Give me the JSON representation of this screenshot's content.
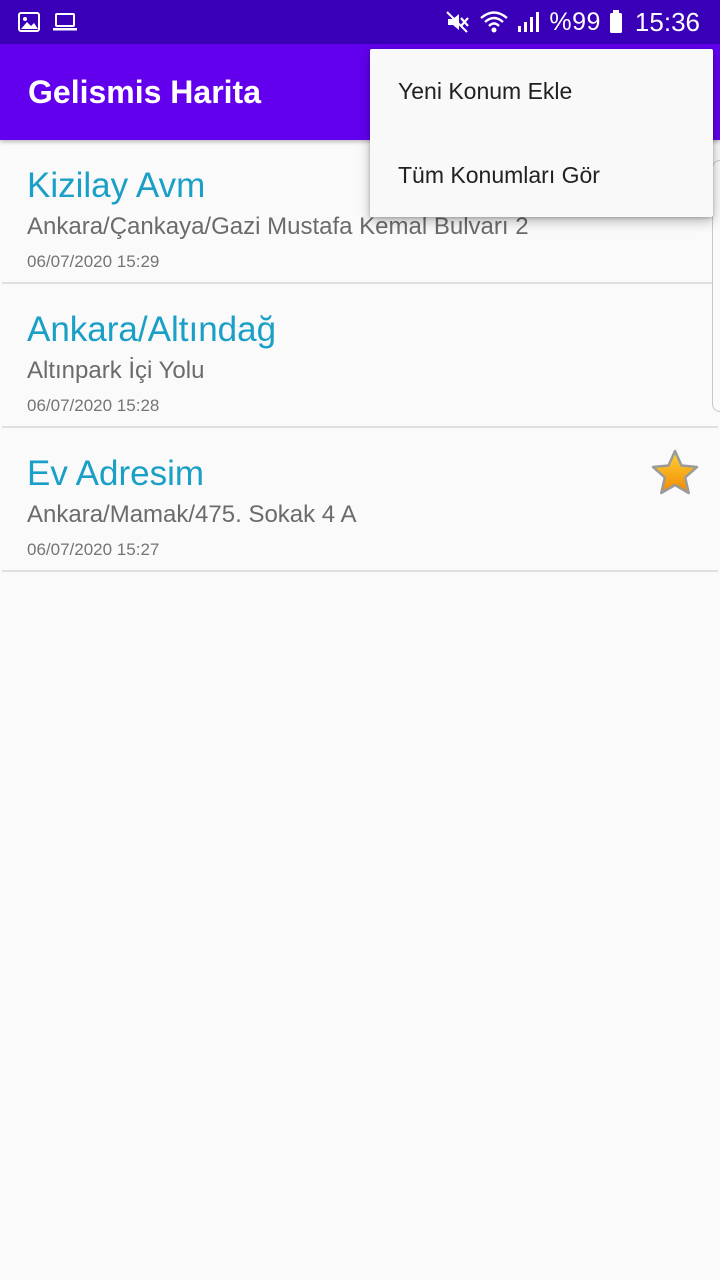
{
  "status_bar": {
    "battery_text": "%99",
    "time": "15:36",
    "icons": [
      "gallery-icon",
      "laptop-icon",
      "mute-icon",
      "wifi-icon",
      "signal-icon",
      "battery-icon"
    ]
  },
  "app_bar": {
    "title": "Gelismis Harita"
  },
  "overflow_menu": {
    "items": [
      {
        "label": "Yeni Konum Ekle"
      },
      {
        "label": "Tüm Konumları Gör"
      }
    ]
  },
  "locations": [
    {
      "title": "Kizilay Avm",
      "address": "Ankara/Çankaya/Gazi Mustafa Kemal Bulvarı 2",
      "date": "06/07/2020 15:29",
      "favorite": false
    },
    {
      "title": "Ankara/Altındağ",
      "address": "Altınpark İçi Yolu",
      "date": "06/07/2020 15:28",
      "favorite": false
    },
    {
      "title": "Ev Adresim",
      "address": "Ankara/Mamak/475. Sokak 4 A",
      "date": "06/07/2020 15:27",
      "favorite": true
    }
  ],
  "colors": {
    "status_bar": "#3a00b8",
    "app_bar": "#6200ee",
    "title_text": "#1a9fc6",
    "star_fill": "#f7a400"
  }
}
